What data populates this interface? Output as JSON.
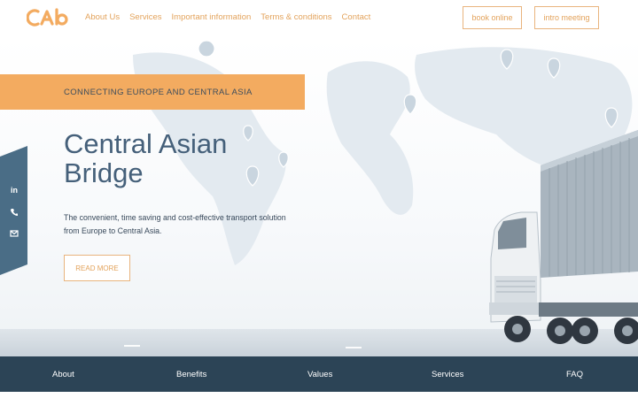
{
  "header": {
    "logo_text": "CAb",
    "nav": [
      "About Us",
      "Services",
      "Important information",
      "Terms & conditions",
      "Contact"
    ],
    "book_label": "book online",
    "intro_label": "intro meeting"
  },
  "hero": {
    "kicker": "CONNECTING EUROPE AND CENTRAL ASIA",
    "title": "Central Asian\nBridge",
    "description": "The convenient, time saving and cost-effective transport solution from Europe to Central Asia.",
    "read_more": "READ MORE",
    "social_icons": [
      "linkedin-icon",
      "phone-icon",
      "email-icon"
    ]
  },
  "footer_nav": [
    "About",
    "Benefits",
    "Values",
    "Services",
    "FAQ"
  ],
  "colors": {
    "accent": "#f3ab60",
    "accent_text": "#e3a35c",
    "heading": "#45607a",
    "dark_bar": "#2c4456",
    "social_panel": "#4a6d86"
  }
}
